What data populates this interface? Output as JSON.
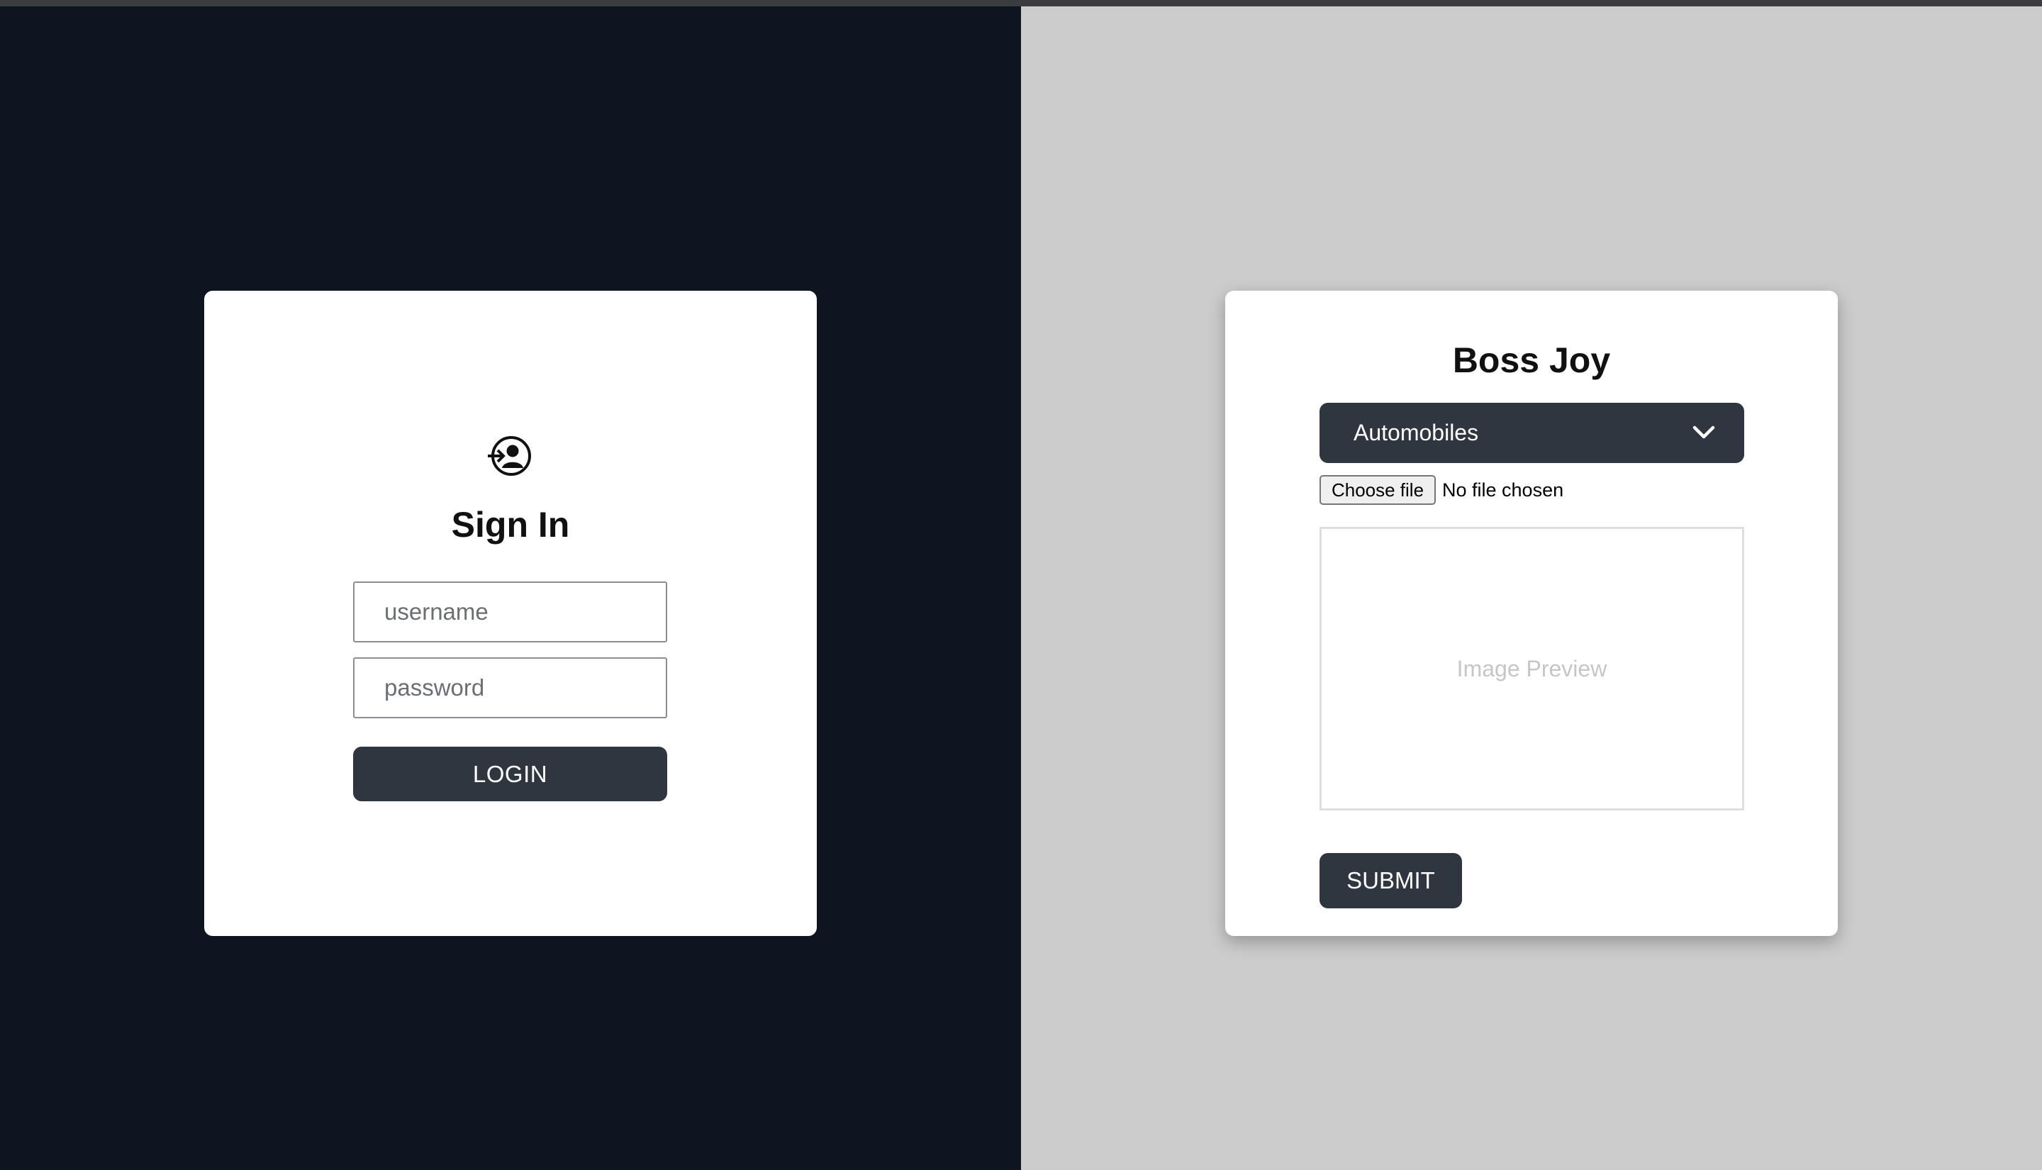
{
  "signin": {
    "icon": "login-user-icon",
    "title": "Sign In",
    "username_placeholder": "username",
    "password_placeholder": "password",
    "login_label": "LOGIN"
  },
  "upload": {
    "title": "Boss Joy",
    "category": {
      "selected": "Automobiles",
      "icon": "chevron-down-icon"
    },
    "file": {
      "button_label": "Choose file",
      "status": "No file chosen"
    },
    "preview_placeholder": "Image Preview",
    "submit_label": "SUBMIT"
  },
  "colors": {
    "left_background": "#0e1520",
    "right_background": "#cccccc",
    "card_background": "#ffffff",
    "button_dark": "#30363f"
  }
}
